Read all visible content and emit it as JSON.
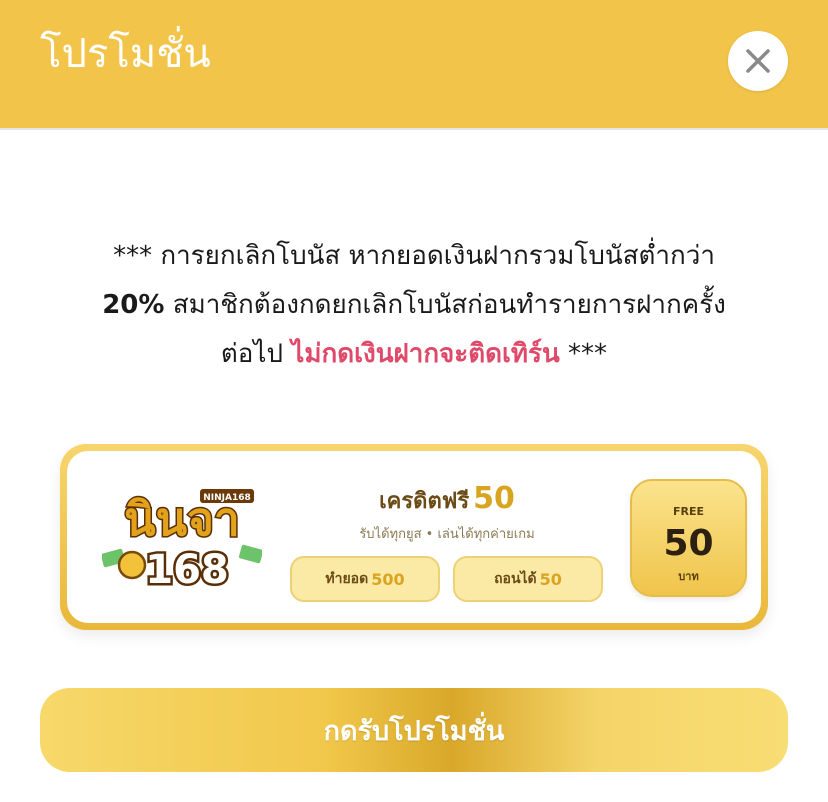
{
  "header": {
    "title": "โปรโมชั่น",
    "close_icon": "close-icon"
  },
  "notice": {
    "line1": "*** การยกเลิกโบนัส หากยอดเงินฝากรวมโบนัสต่ำกว่า",
    "line2_bold": "20%",
    "line2_rest": " สมาชิกต้องกดยกเลิกโบนัสก่อนทำรายการฝากครั้ง",
    "line3_start": "ต่อไป ",
    "line3_highlight": "ไม่กดเงินฝากจะติดเทิร์น",
    "line3_end": " ***",
    "highlight_color": "#e04a6a"
  },
  "promo_card": {
    "logo": {
      "name": "NINJA168 logo",
      "main_text": "นินจา",
      "number": "168",
      "tag": "NINJA168"
    },
    "title": "เครดิตฟรี",
    "title_amount": "50",
    "subtitle": "รับได้ทุกยูส • เล่นได้ทุกค่ายเกม",
    "turnover": {
      "label": "ทำยอด",
      "value": "500"
    },
    "withdraw": {
      "label": "ถอนได้",
      "value": "50"
    },
    "badge": {
      "label": "FREE",
      "amount": "50",
      "unit": "บาท"
    }
  },
  "cta": {
    "label": "กดรับโปรโมชั่น"
  },
  "colors": {
    "accent": "#f2c54a",
    "gold": "#d9a520",
    "brown": "#6b4a14"
  }
}
